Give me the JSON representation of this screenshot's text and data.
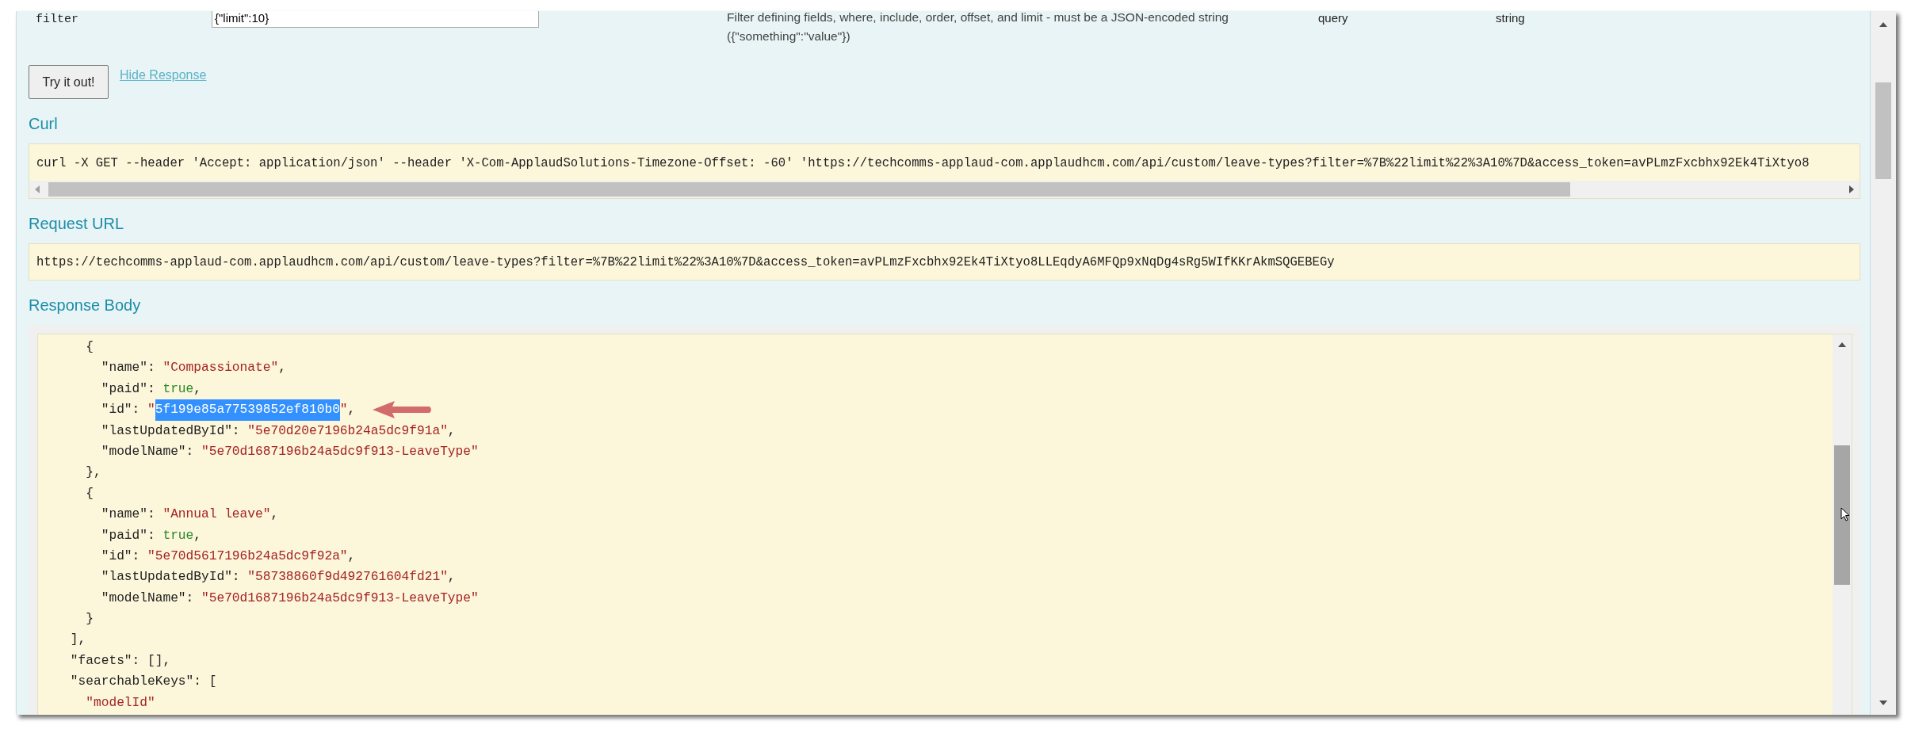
{
  "parameter": {
    "name": "filter",
    "value": "{\"limit\":10}",
    "description": "Filter defining fields, where, include, order, offset, and limit - must be a JSON-encoded string ({\"something\":\"value\"})",
    "parameter_type": "query",
    "data_type": "string"
  },
  "try_button": "Try it out!",
  "hide_link": "Hide Response",
  "curl": {
    "heading": "Curl",
    "command": "curl -X GET --header 'Accept: application/json' --header 'X-Com-ApplaudSolutions-Timezone-Offset: -60' 'https://techcomms-applaud-com.applaudhcm.com/api/custom/leave-types?filter=%7B%22limit%22%3A10%7D&access_token=avPLmzFxcbhx92Ek4TiXtyo8"
  },
  "request_url": {
    "heading": "Request URL",
    "url": "https://techcomms-applaud-com.applaudhcm.com/api/custom/leave-types?filter=%7B%22limit%22%3A10%7D&access_token=avPLmzFxcbhx92Ek4TiXtyo8LLEqdyA6MFQp9xNqDg4sRg5WIfKKrAkmSQGEBEGy"
  },
  "response_body": {
    "heading": "Response Body",
    "lines": [
      {
        "tokens": [
          {
            "kind": "plain",
            "text": "      {"
          }
        ]
      },
      {
        "tokens": [
          {
            "kind": "plain",
            "text": "        \"name\": "
          },
          {
            "kind": "string",
            "text": "\"Compassionate\""
          },
          {
            "kind": "plain",
            "text": ","
          }
        ]
      },
      {
        "tokens": [
          {
            "kind": "plain",
            "text": "        \"paid\": "
          },
          {
            "kind": "boolean",
            "text": "true"
          },
          {
            "kind": "plain",
            "text": ","
          }
        ]
      },
      {
        "tokens": [
          {
            "kind": "plain",
            "text": "        \"id\": "
          },
          {
            "kind": "string",
            "text": "\""
          },
          {
            "kind": "selection",
            "text": "5f199e85a77539852ef810b0"
          },
          {
            "kind": "string",
            "text": "\""
          },
          {
            "kind": "plain",
            "text": ","
          }
        ],
        "marked": true
      },
      {
        "tokens": [
          {
            "kind": "plain",
            "text": "        \"lastUpdatedById\": "
          },
          {
            "kind": "string",
            "text": "\"5e70d20e7196b24a5dc9f91a\""
          },
          {
            "kind": "plain",
            "text": ","
          }
        ]
      },
      {
        "tokens": [
          {
            "kind": "plain",
            "text": "        \"modelName\": "
          },
          {
            "kind": "string",
            "text": "\"5e70d1687196b24a5dc9f913-LeaveType\""
          }
        ]
      },
      {
        "tokens": [
          {
            "kind": "plain",
            "text": "      },"
          }
        ]
      },
      {
        "tokens": [
          {
            "kind": "plain",
            "text": "      {"
          }
        ]
      },
      {
        "tokens": [
          {
            "kind": "plain",
            "text": "        \"name\": "
          },
          {
            "kind": "string",
            "text": "\"Annual leave\""
          },
          {
            "kind": "plain",
            "text": ","
          }
        ]
      },
      {
        "tokens": [
          {
            "kind": "plain",
            "text": "        \"paid\": "
          },
          {
            "kind": "boolean",
            "text": "true"
          },
          {
            "kind": "plain",
            "text": ","
          }
        ]
      },
      {
        "tokens": [
          {
            "kind": "plain",
            "text": "        \"id\": "
          },
          {
            "kind": "string",
            "text": "\"5e70d5617196b24a5dc9f92a\""
          },
          {
            "kind": "plain",
            "text": ","
          }
        ]
      },
      {
        "tokens": [
          {
            "kind": "plain",
            "text": "        \"lastUpdatedById\": "
          },
          {
            "kind": "string",
            "text": "\"58738860f9d492761604fd21\""
          },
          {
            "kind": "plain",
            "text": ","
          }
        ]
      },
      {
        "tokens": [
          {
            "kind": "plain",
            "text": "        \"modelName\": "
          },
          {
            "kind": "string",
            "text": "\"5e70d1687196b24a5dc9f913-LeaveType\""
          }
        ]
      },
      {
        "tokens": [
          {
            "kind": "plain",
            "text": "      }"
          }
        ]
      },
      {
        "tokens": [
          {
            "kind": "plain",
            "text": "    ],"
          }
        ]
      },
      {
        "tokens": [
          {
            "kind": "plain",
            "text": "    \"facets\": [],"
          }
        ]
      },
      {
        "tokens": [
          {
            "kind": "plain",
            "text": "    \"searchableKeys\": ["
          }
        ]
      },
      {
        "tokens": [
          {
            "kind": "string",
            "text": "      \"modelId\""
          }
        ]
      }
    ]
  }
}
